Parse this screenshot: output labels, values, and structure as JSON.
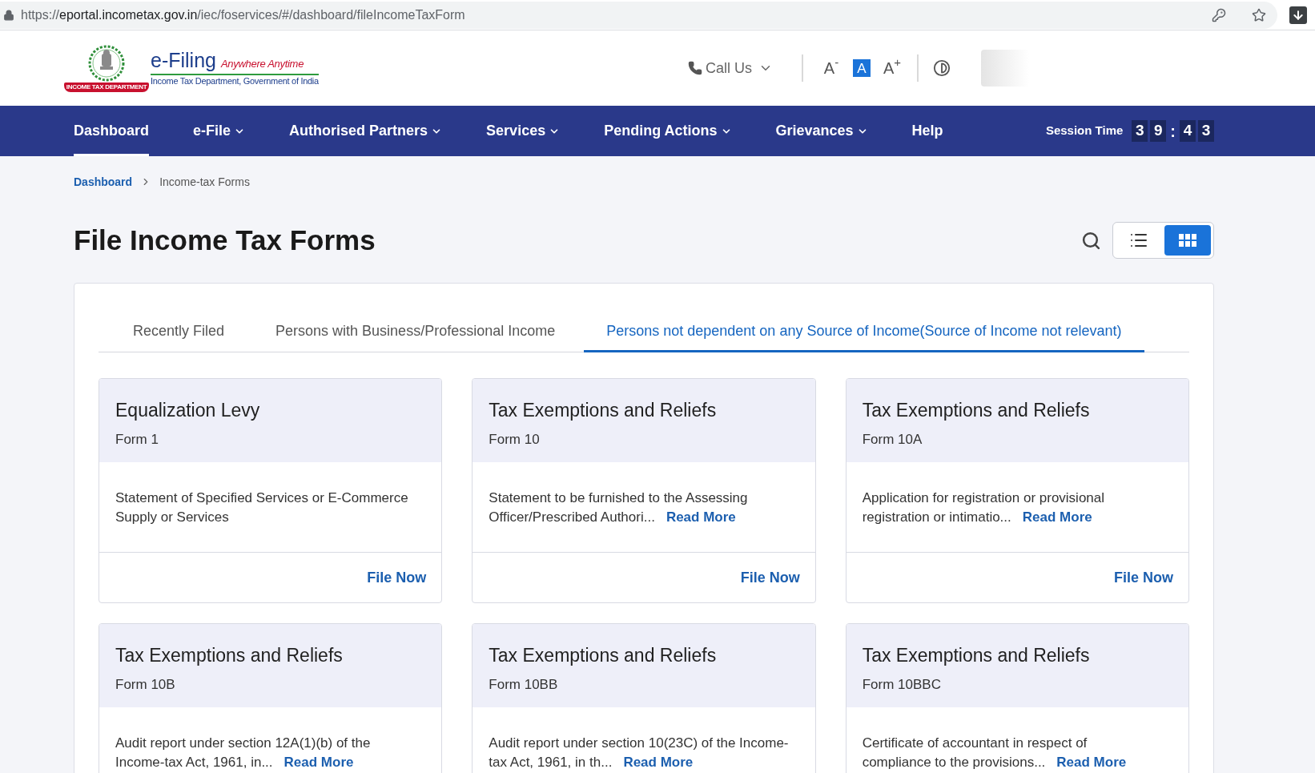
{
  "browser": {
    "url_scheme": "https://",
    "url_host": "eportal.incometax.gov.in",
    "url_path": "/iec/foservices/#/dashboard/fileIncomeTaxForm"
  },
  "header": {
    "logo": {
      "ribbon": "INCOME TAX DEPARTMENT",
      "title": "e-Filing",
      "tagline": "Anywhere Anytime",
      "subtitle": "Income Tax Department, Government of India"
    },
    "call_us": "Call Us",
    "font_sizes": [
      {
        "label": "A$^{-}$",
        "selected": false
      },
      {
        "label": "A",
        "selected": true
      },
      {
        "label": "A$^{+}$",
        "selected": false
      }
    ]
  },
  "nav": {
    "items": [
      {
        "label": "Dashboard",
        "dropdown": false,
        "selected": true
      },
      {
        "label": "e-File",
        "dropdown": true,
        "selected": false
      },
      {
        "label": "Authorised Partners",
        "dropdown": true,
        "selected": false
      },
      {
        "label": "Services",
        "dropdown": true,
        "selected": false
      },
      {
        "label": "Pending Actions",
        "dropdown": true,
        "selected": false
      },
      {
        "label": "Grievances",
        "dropdown": true,
        "selected": false
      },
      {
        "label": "Help",
        "dropdown": false,
        "selected": false
      }
    ],
    "session": {
      "label": "Session Time",
      "minutes": [
        "3",
        "9"
      ],
      "separator": ":",
      "seconds": [
        "4",
        "3"
      ]
    }
  },
  "breadcrumb": [
    {
      "label": "Dashboard",
      "current": false
    },
    {
      "label": "Income-tax Forms",
      "current": true
    }
  ],
  "page_title": "File Income Tax Forms",
  "view_toggle": [
    {
      "kind": "list",
      "selected": false
    },
    {
      "kind": "grid",
      "selected": true
    }
  ],
  "tabs": [
    {
      "label": "Recently Filed",
      "selected": false
    },
    {
      "label": "Persons with Business/Professional Income",
      "selected": false
    },
    {
      "label": "Persons not dependent on any Source of Income(Source of Income not relevant)",
      "selected": true
    }
  ],
  "cards": [
    {
      "title": "Equalization Levy",
      "form": "Form 1",
      "description": [
        "Statement of Specified Services or E-Commerce",
        "Supply or Services"
      ],
      "action": "File Now"
    },
    {
      "title": "Tax Exemptions and Reliefs",
      "form": "Form 10",
      "description": [
        "Statement to be furnished to the Assessing",
        "Officer/Prescribed Authori..."
      ],
      "read_more": "Read More",
      "action": "File Now"
    },
    {
      "title": "Tax Exemptions and Reliefs",
      "form": "Form 10A",
      "description": [
        "Application for registration or provisional",
        "registration or intimatio..."
      ],
      "read_more": "Read More",
      "action": "File Now"
    },
    {
      "title": "Tax Exemptions and Reliefs",
      "form": "Form 10B",
      "description": [
        "Audit report under section 12A(1)(b) of the",
        "Income-tax Act, 1961, in..."
      ],
      "read_more": "Read More"
    },
    {
      "title": "Tax Exemptions and Reliefs",
      "form": "Form 10BB",
      "description": [
        "Audit report under section 10(23C) of the Income-",
        "tax Act, 1961, in th..."
      ],
      "read_more": "Read More"
    },
    {
      "title": "Tax Exemptions and Reliefs",
      "form": "Form 10BBC",
      "description": [
        "Certificate of accountant in respect of",
        "compliance to the provisions..."
      ],
      "read_more": "Read More"
    }
  ]
}
